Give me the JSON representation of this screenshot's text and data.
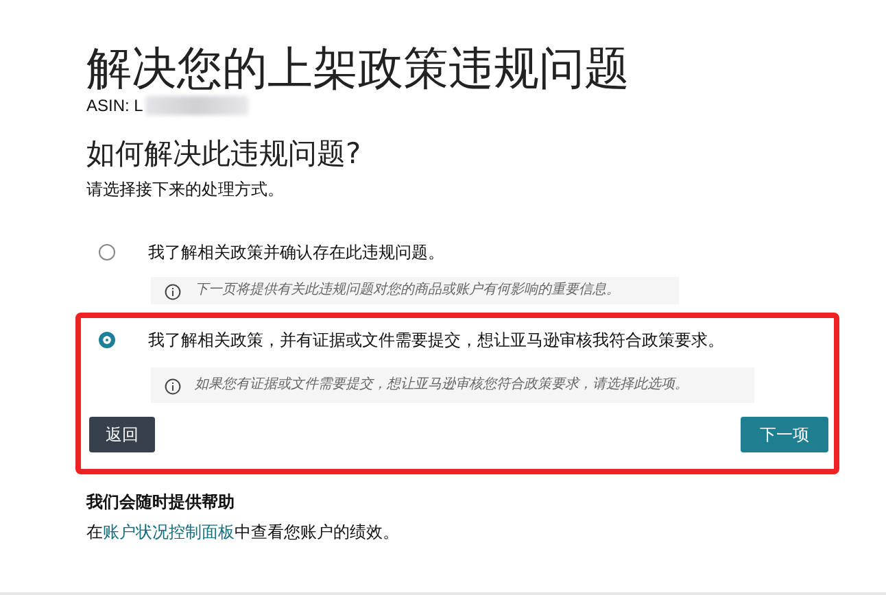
{
  "title": "解决您的上架政策违规问题",
  "asin": "ASIN: L",
  "question": "如何解决此违规问题?",
  "instruction": "请选择接下来的处理方式。",
  "options": [
    {
      "label": "我了解相关政策并确认存在此违规问题。",
      "info": "下一页将提供有关此违规问题对您的商品或账户有何影响的重要信息。",
      "selected": false
    },
    {
      "label": "我了解相关政策，并有证据或文件需要提交，想让亚马逊审核我符合政策要求。",
      "info": "如果您有证据或文件需要提交，想让亚马逊审核您符合政策要求，请选择此选项。",
      "selected": true
    }
  ],
  "buttons": {
    "back": "返回",
    "next": "下一项"
  },
  "help": {
    "heading": "我们会随时提供帮助",
    "before": "在",
    "link": "账户状况控制面板",
    "after": "中查看您账户的绩效。"
  }
}
